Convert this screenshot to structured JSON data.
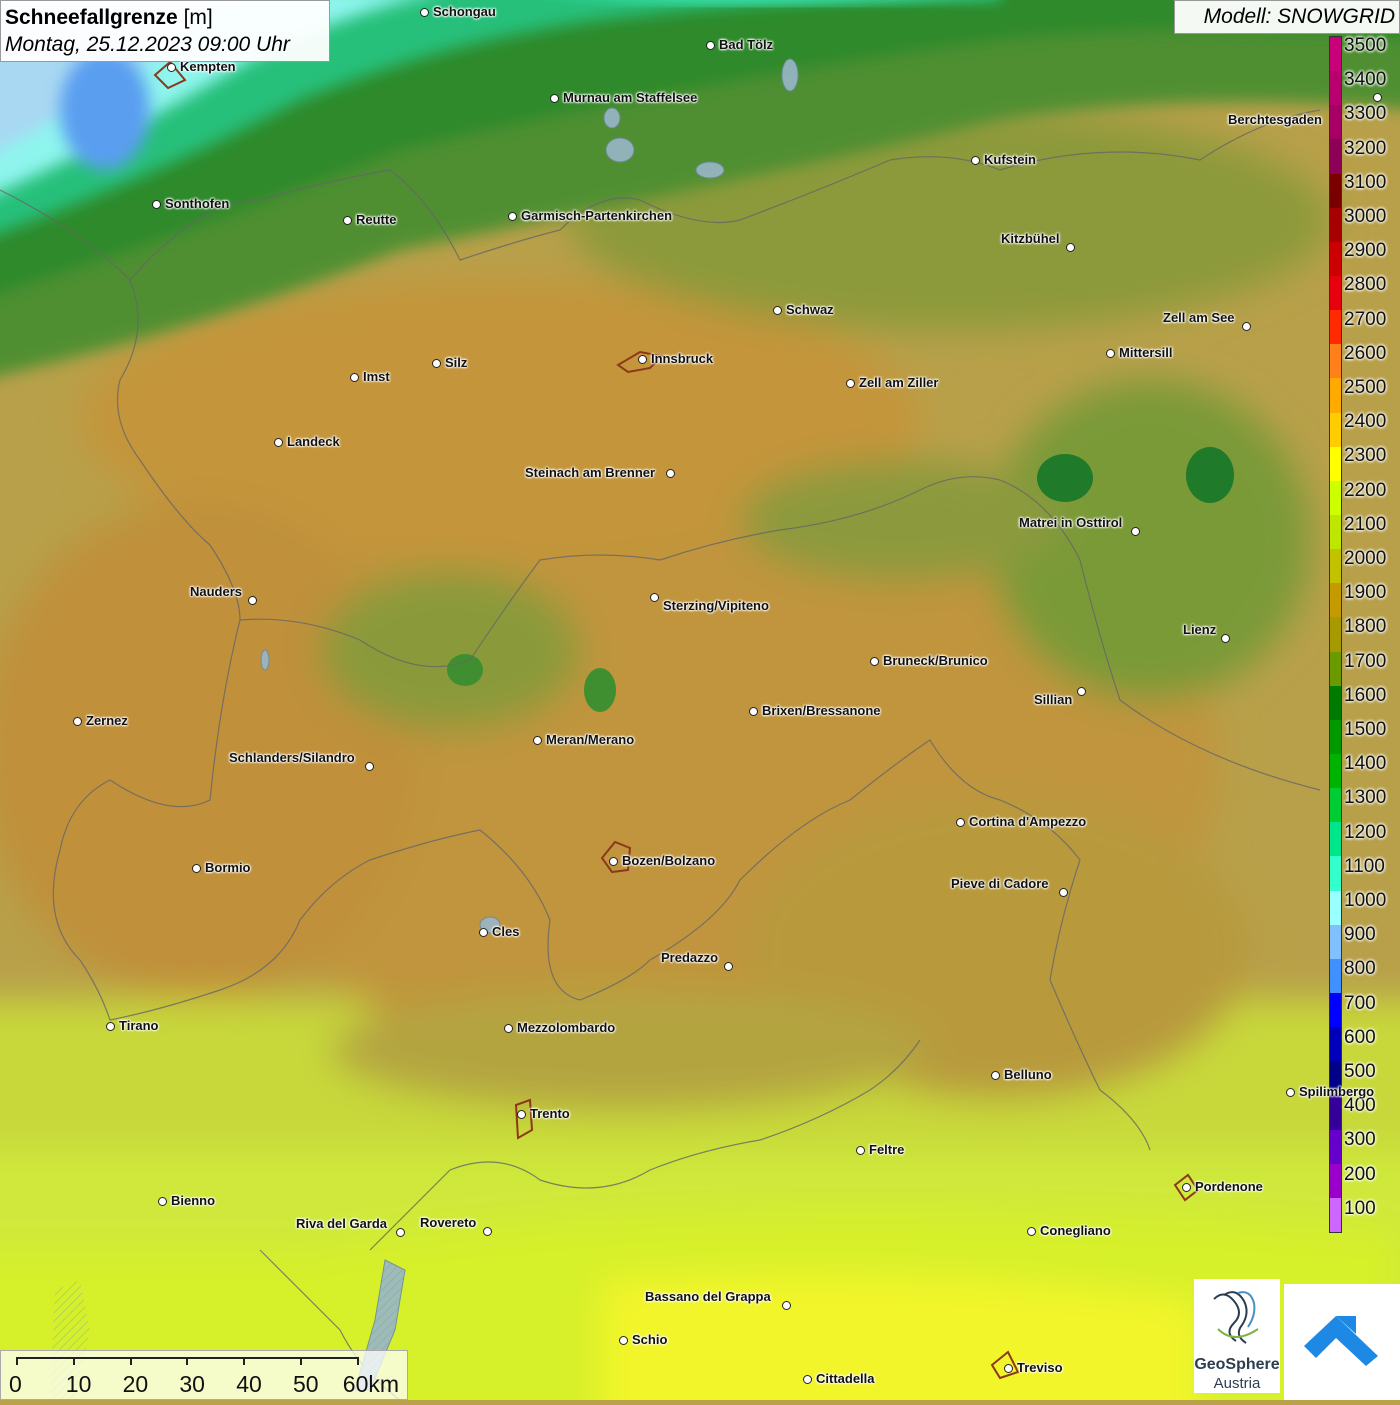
{
  "title": {
    "main": "Schneefallgrenze",
    "unit": "[m]",
    "date": "Montag, 25.12.2023 09:00 Uhr"
  },
  "model": "Modell: SNOWGRID",
  "legend": {
    "labels": [
      "3500",
      "3400",
      "3300",
      "3200",
      "3100",
      "3000",
      "2900",
      "2800",
      "2700",
      "2600",
      "2500",
      "2400",
      "2300",
      "2200",
      "2100",
      "2000",
      "1900",
      "1800",
      "1700",
      "1600",
      "1500",
      "1400",
      "1300",
      "1200",
      "1100",
      "1000",
      "900",
      "800",
      "700",
      "600",
      "500",
      "400",
      "300",
      "200",
      "100"
    ],
    "colors": [
      "#c8007a",
      "#b8006e",
      "#a60066",
      "#8c0058",
      "#7a0000",
      "#a80000",
      "#cc0000",
      "#e60010",
      "#ff2a00",
      "#ff7f1a",
      "#ffaa00",
      "#ffcc00",
      "#ffff00",
      "#ccff00",
      "#bfe600",
      "#c2c200",
      "#c49a00",
      "#a69a00",
      "#6a9a00",
      "#007a00",
      "#009900",
      "#00b300",
      "#00cc33",
      "#00e68a",
      "#33ffcc",
      "#99ffff",
      "#80c0ff",
      "#4090ff",
      "#0000ff",
      "#0000bb",
      "#000088",
      "#330099",
      "#6600cc",
      "#9900cc",
      "#cc66ff"
    ]
  },
  "cities": [
    {
      "name": "Schongau"
    },
    {
      "name": "Bad Tölz"
    },
    {
      "name": "Kempten"
    },
    {
      "name": "Murnau am Staffelsee"
    },
    {
      "name": "Berchtesgaden"
    },
    {
      "name": "Kufstein"
    },
    {
      "name": "Sonthofen"
    },
    {
      "name": "Reutte"
    },
    {
      "name": "Garmisch-Partenkirchen"
    },
    {
      "name": "Kitzbühel"
    },
    {
      "name": "Schwaz"
    },
    {
      "name": "Zell am See"
    },
    {
      "name": "Innsbruck"
    },
    {
      "name": "Mittersill"
    },
    {
      "name": "Silz"
    },
    {
      "name": "Imst"
    },
    {
      "name": "Zell am Ziller"
    },
    {
      "name": "Landeck"
    },
    {
      "name": "Steinach am Brenner"
    },
    {
      "name": "Matrei in Osttirol"
    },
    {
      "name": "Nauders"
    },
    {
      "name": "Sterzing/Vipiteno"
    },
    {
      "name": "Lienz"
    },
    {
      "name": "Bruneck/Brunico"
    },
    {
      "name": "Sillian"
    },
    {
      "name": "Zernez"
    },
    {
      "name": "Brixen/Bressanone"
    },
    {
      "name": "Meran/Merano"
    },
    {
      "name": "Schlanders/Silandro"
    },
    {
      "name": "Cortina d'Ampezzo"
    },
    {
      "name": "Bormio"
    },
    {
      "name": "Bozen/Bolzano"
    },
    {
      "name": "Pieve di Cadore"
    },
    {
      "name": "Cles"
    },
    {
      "name": "Predazzo"
    },
    {
      "name": "Tirano"
    },
    {
      "name": "Mezzolombardo"
    },
    {
      "name": "Belluno"
    },
    {
      "name": "Spilimbergo"
    },
    {
      "name": "Trento"
    },
    {
      "name": "Feltre"
    },
    {
      "name": "Pordenone"
    },
    {
      "name": "Bienno"
    },
    {
      "name": "Riva del Garda"
    },
    {
      "name": "Rovereto"
    },
    {
      "name": "Conegliano"
    },
    {
      "name": "Bassano del Grappa"
    },
    {
      "name": "Schio"
    },
    {
      "name": "Treviso"
    },
    {
      "name": "Cittadella"
    }
  ],
  "scale": {
    "labels": [
      "0",
      "10",
      "20",
      "30",
      "40",
      "50",
      "60km"
    ]
  },
  "logos": {
    "geo_line1": "GeoSphere",
    "geo_line2": "Austria"
  }
}
